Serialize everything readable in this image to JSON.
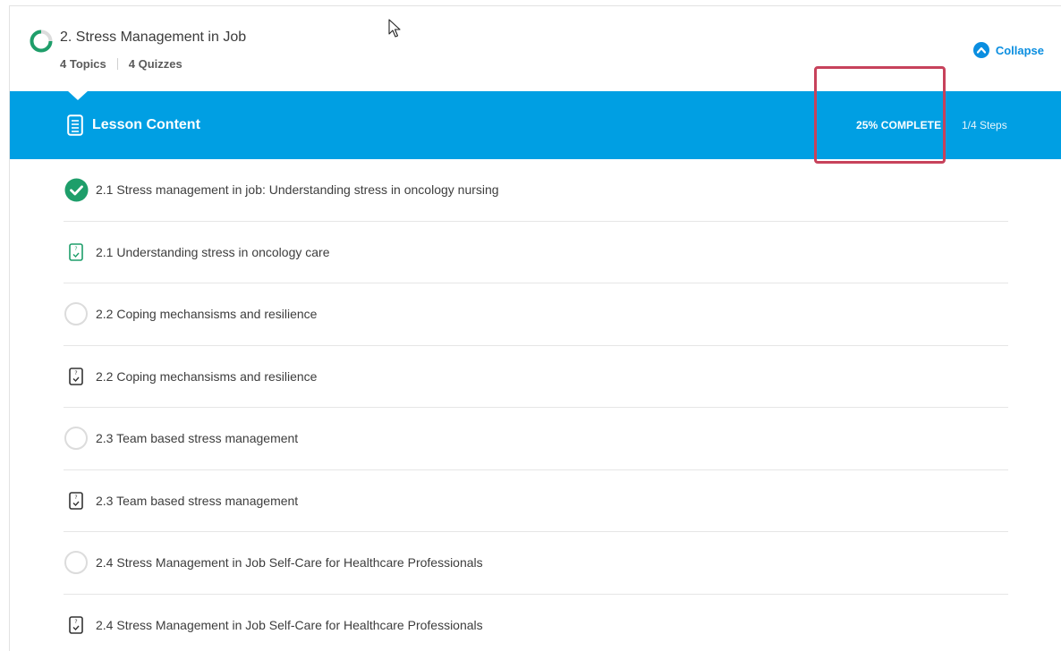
{
  "header": {
    "title": "2. Stress Management in Job",
    "topics": "4 Topics",
    "quizzes": "4 Quizzes",
    "collapse_label": "Collapse"
  },
  "content_bar": {
    "title": "Lesson Content",
    "complete": "25% COMPLETE",
    "steps": "1/4 Steps",
    "progress_fraction": 0.25
  },
  "items": [
    {
      "label": "2.1 Stress management in job: Understanding stress in oncology nursing",
      "icon": "check-circle-icon",
      "status": "complete"
    },
    {
      "label": "2.1 Understanding stress in oncology care",
      "icon": "quiz-icon",
      "status": "quiz-complete"
    },
    {
      "label": "2.2 Coping mechansisms and resilience",
      "icon": "empty-circle-icon",
      "status": "incomplete"
    },
    {
      "label": "2.2 Coping mechansisms and resilience",
      "icon": "quiz-icon",
      "status": "quiz"
    },
    {
      "label": "2.3 Team based stress management",
      "icon": "empty-circle-icon",
      "status": "incomplete"
    },
    {
      "label": "2.3 Team based stress management",
      "icon": "quiz-icon",
      "status": "quiz"
    },
    {
      "label": "2.4 Stress Management in Job Self-Care for Healthcare Professionals",
      "icon": "empty-circle-icon",
      "status": "incomplete"
    },
    {
      "label": "2.4 Stress Management in Job Self-Care for Healthcare Professionals",
      "icon": "quiz-icon",
      "status": "quiz"
    }
  ],
  "colors": {
    "accent": "#009fe3",
    "link": "#0a8ee0",
    "success": "#1e9e6a",
    "highlight": "#c7425b"
  }
}
